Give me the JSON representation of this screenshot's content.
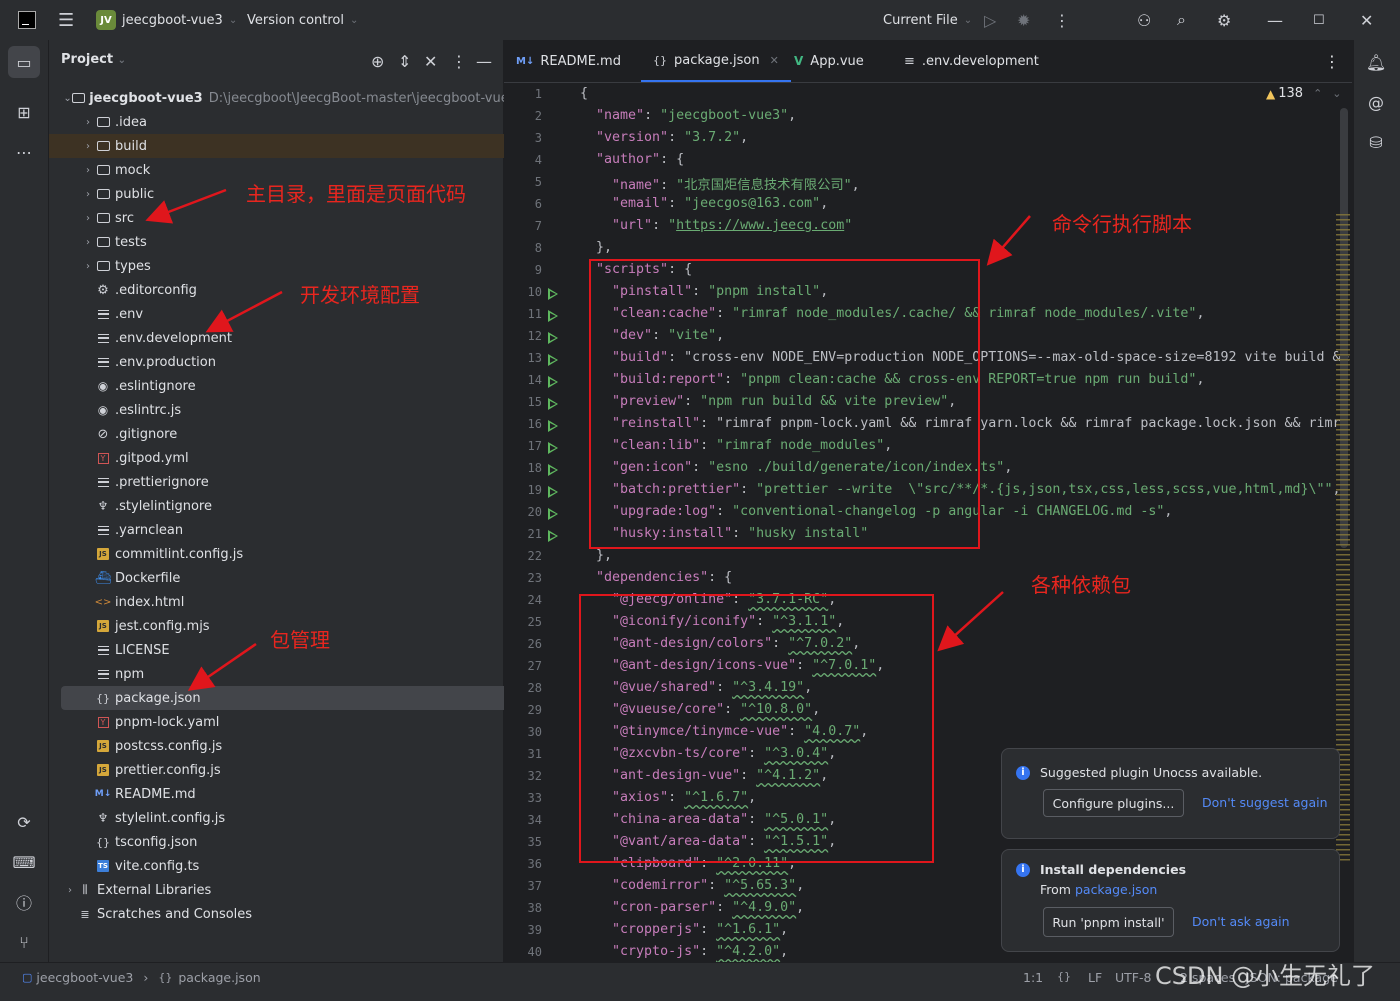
{
  "titlebar": {
    "project_badge": "JV",
    "project_name": "jeecgboot-vue3",
    "version_control": "Version control",
    "run_config": "Current File"
  },
  "project_panel": {
    "title": "Project",
    "root_name": "jeecgboot-vue3",
    "root_path": "D:\\jeecgboot\\JeecgBoot-master\\jeecgboot-vue3",
    "items": [
      {
        "label": ".idea",
        "kind": "folder"
      },
      {
        "label": "build",
        "kind": "folder"
      },
      {
        "label": "mock",
        "kind": "folder"
      },
      {
        "label": "public",
        "kind": "folder"
      },
      {
        "label": "src",
        "kind": "folder"
      },
      {
        "label": "tests",
        "kind": "folder"
      },
      {
        "label": "types",
        "kind": "folder"
      },
      {
        "label": ".editorconfig",
        "kind": "gear"
      },
      {
        "label": ".env",
        "kind": "lines"
      },
      {
        "label": ".env.development",
        "kind": "lines"
      },
      {
        "label": ".env.production",
        "kind": "lines"
      },
      {
        "label": ".eslintignore",
        "kind": "dot"
      },
      {
        "label": ".eslintrc.js",
        "kind": "dot"
      },
      {
        "label": ".gitignore",
        "kind": "ban"
      },
      {
        "label": ".gitpod.yml",
        "kind": "yaml"
      },
      {
        "label": ".prettierignore",
        "kind": "lines"
      },
      {
        "label": ".stylelintignore",
        "kind": "stylelint"
      },
      {
        "label": ".yarnclean",
        "kind": "lines"
      },
      {
        "label": "commitlint.config.js",
        "kind": "js"
      },
      {
        "label": "Dockerfile",
        "kind": "docker"
      },
      {
        "label": "index.html",
        "kind": "html"
      },
      {
        "label": "jest.config.mjs",
        "kind": "js"
      },
      {
        "label": "LICENSE",
        "kind": "lines"
      },
      {
        "label": "npm",
        "kind": "lines"
      },
      {
        "label": "package.json",
        "kind": "json"
      },
      {
        "label": "pnpm-lock.yaml",
        "kind": "yaml"
      },
      {
        "label": "postcss.config.js",
        "kind": "js"
      },
      {
        "label": "prettier.config.js",
        "kind": "js"
      },
      {
        "label": "README.md",
        "kind": "md"
      },
      {
        "label": "stylelint.config.js",
        "kind": "stylelint"
      },
      {
        "label": "tsconfig.json",
        "kind": "json"
      },
      {
        "label": "vite.config.ts",
        "kind": "ts"
      }
    ],
    "external_libraries": "External Libraries",
    "scratches": "Scratches and Consoles"
  },
  "editor": {
    "tabs": [
      {
        "label": "README.md",
        "icon": "M↓"
      },
      {
        "label": "package.json",
        "icon": "{}"
      },
      {
        "label": "App.vue",
        "icon": "V"
      },
      {
        "label": ".env.development",
        "icon": "≡"
      }
    ],
    "warning_count": "138",
    "lines": [
      {
        "n": "1",
        "code": "{"
      },
      {
        "n": "2",
        "code": "  \"name\": \"jeecgboot-vue3\","
      },
      {
        "n": "3",
        "code": "  \"version\": \"3.7.2\","
      },
      {
        "n": "4",
        "code": "  \"author\": {"
      },
      {
        "n": "5",
        "code": "    \"name\": \"北京国炬信息技术有限公司\","
      },
      {
        "n": "6",
        "code": "    \"email\": \"jeecgos@163.com\","
      },
      {
        "n": "7",
        "code": "    \"url\": \"https://www.jeecg.com\""
      },
      {
        "n": "8",
        "code": "  },"
      },
      {
        "n": "9",
        "code": "  \"scripts\": {"
      },
      {
        "n": "10",
        "code": "    \"pinstall\": \"pnpm install\","
      },
      {
        "n": "11",
        "code": "    \"clean:cache\": \"rimraf node_modules/.cache/ && rimraf node_modules/.vite\","
      },
      {
        "n": "12",
        "code": "    \"dev\": \"vite\","
      },
      {
        "n": "13",
        "code": "    \"build\": \"cross-env NODE_ENV=production NODE_OPTIONS=--max-old-space-size=8192 vite build &&"
      },
      {
        "n": "14",
        "code": "    \"build:report\": \"pnpm clean:cache && cross-env REPORT=true npm run build\","
      },
      {
        "n": "15",
        "code": "    \"preview\": \"npm run build && vite preview\","
      },
      {
        "n": "16",
        "code": "    \"reinstall\": \"rimraf pnpm-lock.yaml && rimraf yarn.lock && rimraf package.lock.json && rimra"
      },
      {
        "n": "17",
        "code": "    \"clean:lib\": \"rimraf node_modules\","
      },
      {
        "n": "18",
        "code": "    \"gen:icon\": \"esno ./build/generate/icon/index.ts\","
      },
      {
        "n": "19",
        "code": "    \"batch:prettier\": \"prettier --write  \\\"src/**/*.{js,json,tsx,css,less,scss,vue,html,md}\\\"\","
      },
      {
        "n": "20",
        "code": "    \"upgrade:log\": \"conventional-changelog -p angular -i CHANGELOG.md -s\","
      },
      {
        "n": "21",
        "code": "    \"husky:install\": \"husky install\""
      },
      {
        "n": "22",
        "code": "  },"
      },
      {
        "n": "23",
        "code": "  \"dependencies\": {"
      },
      {
        "n": "24",
        "code": "    \"@jeecg/online\": \"3.7.1-RC\","
      },
      {
        "n": "25",
        "code": "    \"@iconify/iconify\": \"^3.1.1\","
      },
      {
        "n": "26",
        "code": "    \"@ant-design/colors\": \"^7.0.2\","
      },
      {
        "n": "27",
        "code": "    \"@ant-design/icons-vue\": \"^7.0.1\","
      },
      {
        "n": "28",
        "code": "    \"@vue/shared\": \"^3.4.19\","
      },
      {
        "n": "29",
        "code": "    \"@vueuse/core\": \"^10.8.0\","
      },
      {
        "n": "30",
        "code": "    \"@tinymce/tinymce-vue\": \"4.0.7\","
      },
      {
        "n": "31",
        "code": "    \"@zxcvbn-ts/core\": \"^3.0.4\","
      },
      {
        "n": "32",
        "code": "    \"ant-design-vue\": \"^4.1.2\","
      },
      {
        "n": "33",
        "code": "    \"axios\": \"^1.6.7\","
      },
      {
        "n": "34",
        "code": "    \"china-area-data\": \"^5.0.1\","
      },
      {
        "n": "35",
        "code": "    \"@vant/area-data\": \"^1.5.1\","
      },
      {
        "n": "36",
        "code": "    \"clipboard\": \"^2.0.11\","
      },
      {
        "n": "37",
        "code": "    \"codemirror\": \"^5.65.3\","
      },
      {
        "n": "38",
        "code": "    \"cron-parser\": \"^4.9.0\","
      },
      {
        "n": "39",
        "code": "    \"cropperjs\": \"^1.6.1\","
      },
      {
        "n": "40",
        "code": "    \"crypto-js\": \"^4.2.0\","
      }
    ]
  },
  "notifications": [
    {
      "title": "Suggested plugin Unocss available.",
      "button": "Configure plugins...",
      "link": "Don't suggest again"
    },
    {
      "title": "Install dependencies",
      "from_label": "From",
      "from_link": "package.json",
      "button": "Run 'pnpm install'",
      "link": "Don't ask again"
    }
  ],
  "statusbar": {
    "breadcrumb_project": "jeecgboot-vue3",
    "breadcrumb_file": "package.json",
    "position": "1:1",
    "line_sep": "LF",
    "encoding": "UTF-8",
    "indent": "2 spaces",
    "schema": "JSON: package"
  },
  "annotations": {
    "src_note": "主目录，里面是页面代码",
    "env_note": "开发环境配置",
    "pkg_note": "包管理",
    "scripts_note": "命令行执行脚本",
    "deps_note": "各种依赖包"
  },
  "watermark": "CSDN @小生无礼了",
  "colors": {
    "accent": "#3574f0",
    "annotation_red": "#e0161c",
    "string_green": "#6aab73",
    "key_purple": "#c77dbb"
  }
}
